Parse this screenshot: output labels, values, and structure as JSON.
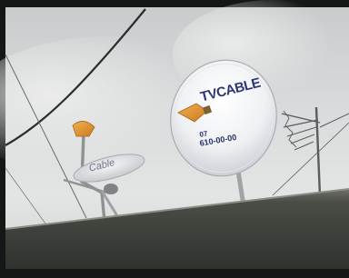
{
  "scene": {
    "description_free": true
  },
  "large_dish": {
    "brand": "TVCABLE",
    "phone_prefix": "07",
    "phone": "610-00-00"
  },
  "small_dish": {
    "brand": "Cable"
  }
}
